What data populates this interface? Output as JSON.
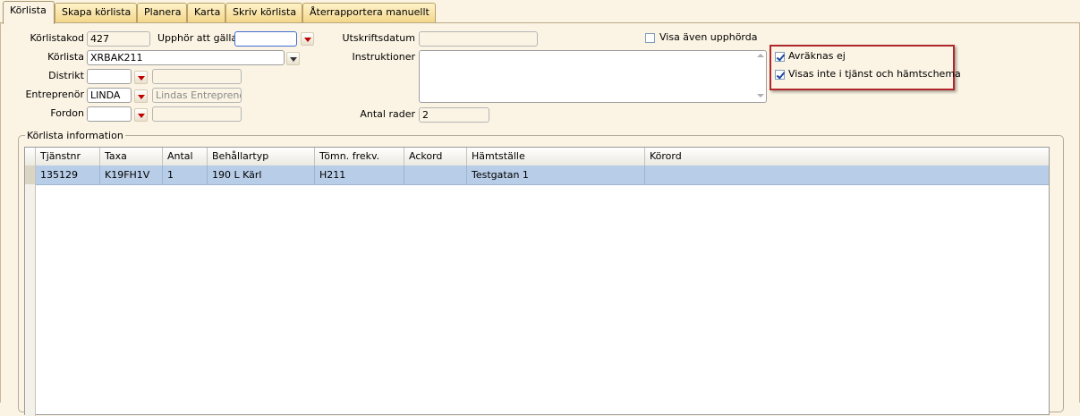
{
  "tabs": [
    {
      "label": "Körlista",
      "active": true
    },
    {
      "label": "Skapa körlista"
    },
    {
      "label": "Planera"
    },
    {
      "label": "Karta"
    },
    {
      "label": "Skriv körlista"
    },
    {
      "label": "Återrapportera manuellt"
    }
  ],
  "form": {
    "korlistakod": {
      "label": "Körlistakod",
      "value": "427"
    },
    "upphor": {
      "label": "Upphör att gälla",
      "value": ""
    },
    "korlista": {
      "label": "Körlista",
      "value": "XRBAK211"
    },
    "distrikt": {
      "label": "Distrikt",
      "value": "",
      "name": ""
    },
    "entreprenor": {
      "label": "Entreprenör",
      "value": "LINDA",
      "name": "Lindas Entreprenör"
    },
    "fordon": {
      "label": "Fordon",
      "value": "",
      "name": ""
    },
    "utskriftsdatum": {
      "label": "Utskriftsdatum",
      "value": ""
    },
    "instruktioner": {
      "label": "Instruktioner",
      "value": ""
    },
    "antal_rader": {
      "label": "Antal rader",
      "value": "2"
    },
    "visa_upphorda": {
      "label": "Visa även upphörda",
      "checked": false
    },
    "avraknas_ej": {
      "label": "Avräknas ej",
      "checked": true
    },
    "visas_inte": {
      "label": "Visas inte i tjänst och hämtschema",
      "checked": true
    }
  },
  "group_title": "Körlista information",
  "grid": {
    "columns": [
      "Tjänstnr",
      "Taxa",
      "Antal",
      "Behållartyp",
      "Tömn. frekv.",
      "Ackord",
      "Hämtställe",
      "Körord"
    ],
    "rows": [
      [
        "135129",
        "K19FH1V",
        "1",
        "190 L Kärl",
        "H211",
        "",
        "Testgatan 1",
        ""
      ]
    ]
  },
  "colors": {
    "highlight_border": "#b1272b",
    "selected_row": "#b8cde7",
    "background": "#fbf4e4"
  }
}
